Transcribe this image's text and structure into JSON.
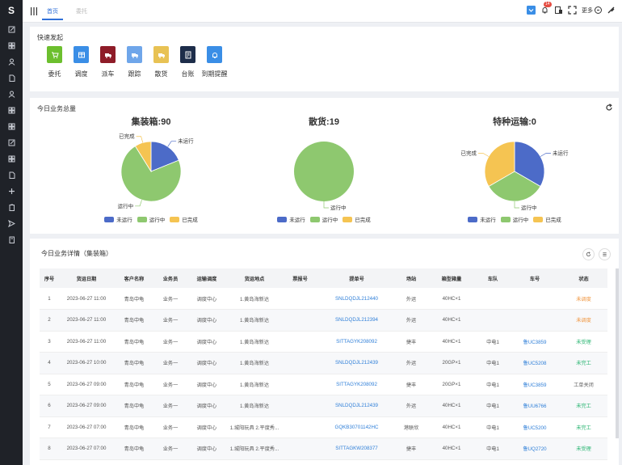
{
  "app": {
    "logo": "S"
  },
  "sidebar": {
    "icons": [
      "edit-icon",
      "grid-icon",
      "user-icon",
      "document-icon",
      "user-icon",
      "grid-icon",
      "grid-icon",
      "edit-icon",
      "grid-icon",
      "document-icon",
      "plus-icon",
      "clipboard-icon",
      "send-icon",
      "book-icon"
    ]
  },
  "topbar": {
    "tabs": [
      {
        "label": "首页"
      },
      {
        "label": "委托"
      }
    ],
    "notification_count": "14",
    "more_label": "更多"
  },
  "quick": {
    "title": "快速发起",
    "items": [
      {
        "label": "委托",
        "color": "#6cbf2e",
        "icon": "cart-icon"
      },
      {
        "label": "调度",
        "color": "#3a8ee6",
        "icon": "box-icon"
      },
      {
        "label": "派车",
        "color": "#8e1c28",
        "icon": "truck-icon"
      },
      {
        "label": "跟踪",
        "color": "#6fa6ea",
        "icon": "truck-icon"
      },
      {
        "label": "散货",
        "color": "#e8c254",
        "icon": "truck-icon"
      },
      {
        "label": "台账",
        "color": "#1d2d4a",
        "icon": "ledger-icon"
      },
      {
        "label": "到期提醒",
        "color": "#3a8ee6",
        "icon": "bell-icon"
      }
    ]
  },
  "summary": {
    "title": "今日业务总量"
  },
  "colors": {
    "not_run": "#4c6bc8",
    "running": "#8ec86f",
    "done": "#f5c452"
  },
  "chart_data": [
    {
      "type": "pie",
      "title": "集装箱:90",
      "categories": [
        "未运行",
        "运行中",
        "已完成"
      ],
      "values": [
        17,
        65,
        8
      ],
      "legend": "bottom"
    },
    {
      "type": "pie",
      "title": "散货:19",
      "categories": [
        "未运行",
        "运行中",
        "已完成"
      ],
      "values": [
        0,
        19,
        0
      ],
      "legend": "bottom"
    },
    {
      "type": "pie",
      "title": "特种运输:0",
      "categories": [
        "未运行",
        "运行中",
        "已完成"
      ],
      "values": [
        1,
        1,
        1
      ],
      "legend": "bottom"
    }
  ],
  "detail": {
    "title": "今日业务详情（集装箱）",
    "columns": [
      "序号",
      "货运日期",
      "客户名称",
      "业务员",
      "运输调度",
      "货运地点",
      "票报号",
      "提单号",
      "场站",
      "箱型箱量",
      "车队",
      "车号",
      "状态"
    ],
    "rows": [
      [
        "1",
        "2023-06-27 11:00",
        "青岛中龟",
        "业务一",
        "调度中心",
        "1.黄岛海新达",
        "",
        "SNLDQDJL212440",
        "外运",
        "40HC×1",
        "",
        "",
        "未调度"
      ],
      [
        "2",
        "2023-06-27 11:00",
        "青岛中龟",
        "业务一",
        "调度中心",
        "1.黄岛海新达",
        "",
        "SNLDQDJL212394",
        "外运",
        "40HC×1",
        "",
        "",
        "未调度"
      ],
      [
        "3",
        "2023-06-27 11:00",
        "青岛中龟",
        "业务一",
        "调度中心",
        "1.黄岛海新达",
        "",
        "SITTAGYK208092",
        "捷丰",
        "40HC×1",
        "中电1",
        "鲁UC3859",
        "未受理"
      ],
      [
        "4",
        "2023-06-27 10:00",
        "青岛中龟",
        "业务一",
        "调度中心",
        "1.黄岛海新达",
        "",
        "SNLDQDJL212439",
        "外运",
        "20GP×1",
        "中电1",
        "鲁UC5208",
        "未完工"
      ],
      [
        "5",
        "2023-06-27 09:00",
        "青岛中龟",
        "业务一",
        "调度中心",
        "1.黄岛海新达",
        "",
        "SITTAGYK208092",
        "捷丰",
        "20GP×1",
        "中电1",
        "鲁UC3859",
        "工单关闭"
      ],
      [
        "6",
        "2023-06-27 09:00",
        "青岛中龟",
        "业务一",
        "调度中心",
        "1.黄岛海新达",
        "",
        "SNLDQDJL212439",
        "外运",
        "40HC×1",
        "中电1",
        "鲁UU6766",
        "未完工"
      ],
      [
        "7",
        "2023-06-27 07:00",
        "青岛中龟",
        "业务一",
        "调度中心",
        "1.城阳玩具 2.平度秀...",
        "",
        "GQKB30701142HC",
        "港联欣",
        "40HC×1",
        "中电1",
        "鲁UC5200",
        "未完工"
      ],
      [
        "8",
        "2023-06-27 07:00",
        "青岛中龟",
        "业务一",
        "调度中心",
        "1.城阳玩具 2.平度秀...",
        "",
        "SITTAGKW208377",
        "捷丰",
        "40HC×1",
        "中电1",
        "鲁UQ2720",
        "未受理"
      ]
    ],
    "status_colors": {
      "未调度": "#f0953e",
      "未受理": "#2bb673",
      "未完工": "#2bb673",
      "工单关闭": "#666666"
    }
  }
}
